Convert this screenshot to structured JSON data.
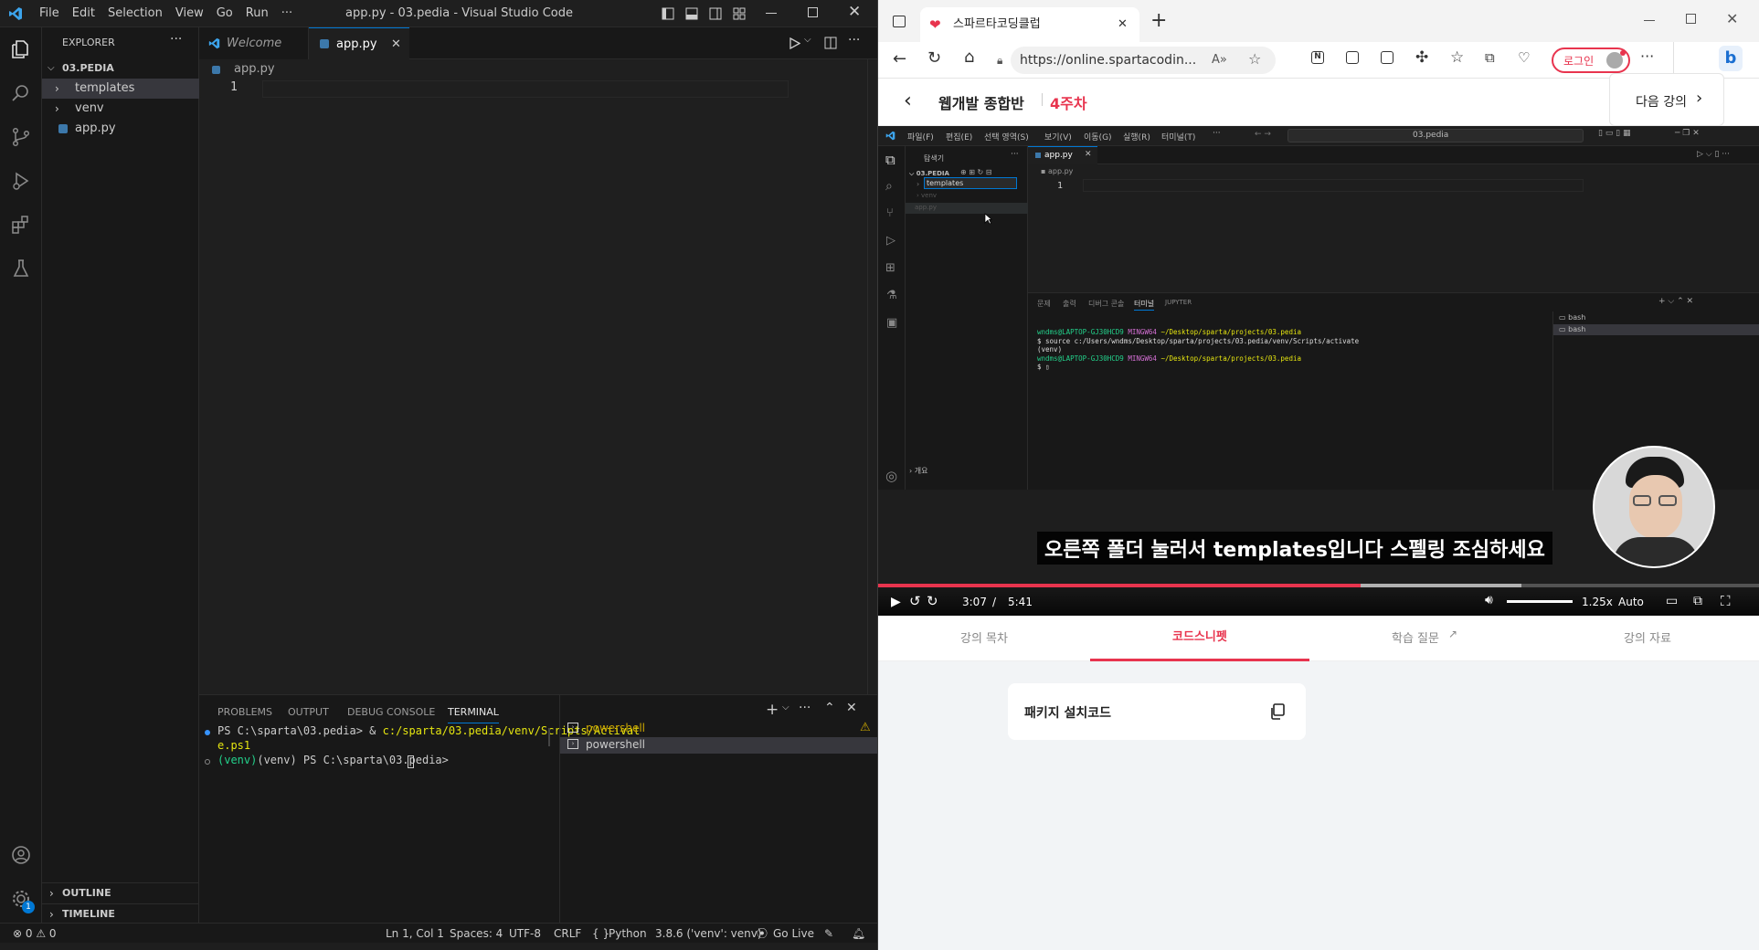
{
  "left": {
    "window_title": "app.py - 03.pedia - Visual Studio Code",
    "menu": [
      "File",
      "Edit",
      "Selection",
      "View",
      "Go",
      "Run",
      "···"
    ],
    "explorer": {
      "title": "EXPLORER",
      "more": "···",
      "root": "03.PEDIA",
      "items": [
        {
          "label": "templates",
          "type": "folder"
        },
        {
          "label": "venv",
          "type": "folder"
        },
        {
          "label": "app.py",
          "type": "file"
        }
      ],
      "outline": "OUTLINE",
      "timeline": "TIMELINE"
    },
    "tabs": [
      {
        "label": "Welcome",
        "active": false
      },
      {
        "label": "app.py",
        "active": true
      }
    ],
    "breadcrumb": "app.py",
    "line_number": "1",
    "panel": {
      "tabs": [
        "PROBLEMS",
        "OUTPUT",
        "DEBUG CONSOLE",
        "TERMINAL"
      ],
      "active_tab": "TERMINAL",
      "terminal_line1_prompt": "PS C:\\sparta\\03.pedia> & ",
      "terminal_line1_cmd": "c:/sparta/03.pedia/venv/Scripts/Activat",
      "terminal_line1_cont": "e.ps1",
      "terminal_line2": "(venv) PS C:\\sparta\\03.pedia> ",
      "shells": [
        "powershell",
        "powershell"
      ]
    },
    "status": {
      "problems": "⊗ 0 ⚠ 0",
      "position": "Ln 1, Col 1",
      "spaces": "Spaces: 4",
      "encoding": "UTF-8",
      "eol": "CRLF",
      "language": "Python",
      "interpreter": "3.8.6 ('venv': venv)",
      "golive": "Go Live",
      "accounts_badge": "1"
    }
  },
  "right": {
    "tab_title": "스파르타코딩클럽",
    "url": "https://online.spartacodin...",
    "login": "로그인",
    "course_title": "웹개발 종합반",
    "week": "4주차",
    "next": "다음 강의",
    "video": {
      "menu": [
        "파일(F)",
        "편집(E)",
        "선택 영역(S)",
        "보기(V)",
        "이동(G)",
        "실행(R)",
        "터미널(T)",
        "···"
      ],
      "search": "03.pedia",
      "explorer_title": "탐색기",
      "root": "03.PEDIA",
      "items": [
        "templates",
        "venv",
        "app.py"
      ],
      "tab": "app.py",
      "breadcrumb": "app.py",
      "line_number": "1",
      "panel_tabs": [
        "문제",
        "출력",
        "디버그 콘솔",
        "터미널",
        "JUPYTER"
      ],
      "term1": "wndms@LAPTOP-GJ30HCD9",
      "term1b": "MINGW64",
      "term1c": "~/Desktop/sparta/projects/03.pedia",
      "term2": "$ source c:/Users/wndms/Desktop/sparta/projects/03.pedia/venv/Scripts/activate",
      "term3": "(venv)",
      "term5": "$ ",
      "shells": [
        "bash",
        "bash"
      ],
      "outline": "개요",
      "subtitle": "오른쪽 폴더 눌러서 templates입니다 스펠링 조심하세요",
      "time_current": "3:07",
      "time_sep": "/",
      "time_total": "5:41",
      "speed": "1.25x",
      "quality": "Auto",
      "progress": 0.548,
      "buffered": 0.73
    },
    "content_tabs": [
      "강의 목차",
      "코드스니펫",
      "학습 질문",
      "강의 자료"
    ],
    "active_content_tab": "코드스니펫",
    "snippet": "패키지 설치코드",
    "accent": "#e8344e"
  }
}
